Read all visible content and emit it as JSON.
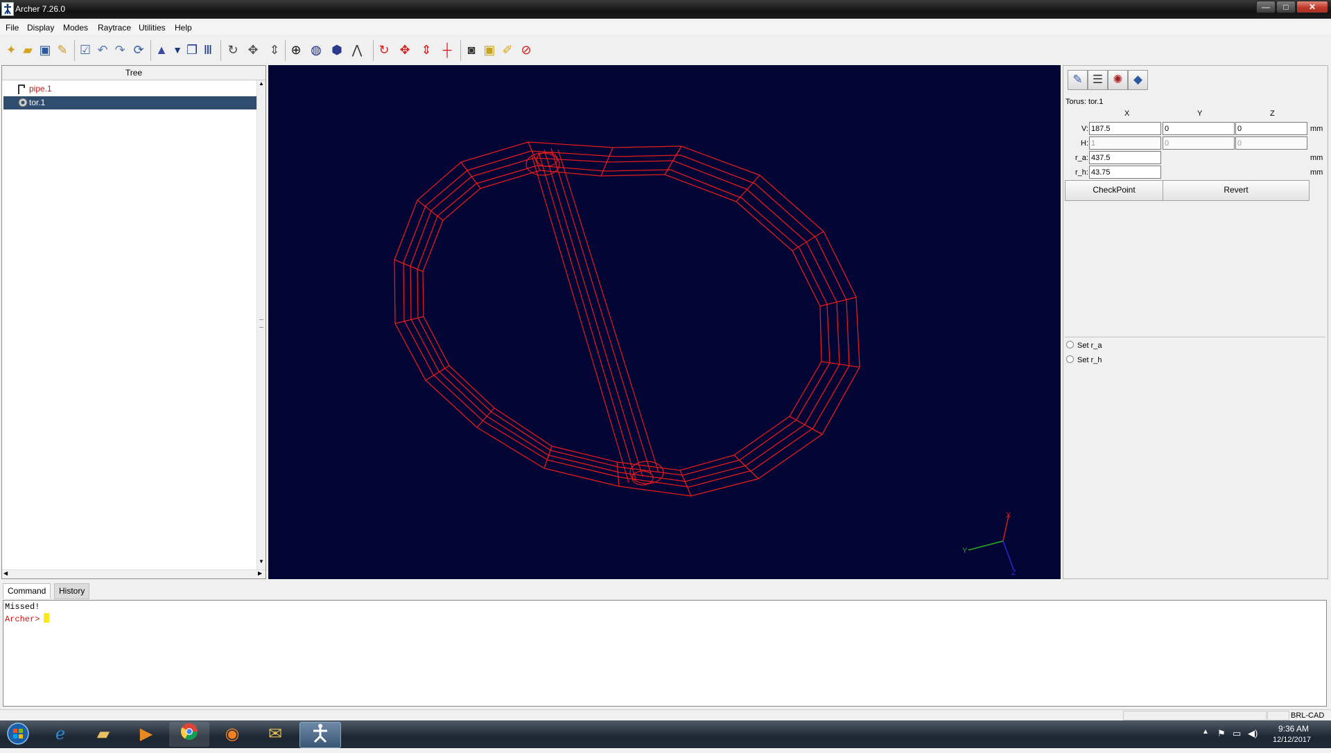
{
  "window": {
    "title": "Archer 7.26.0",
    "minimize_symbol": "—",
    "maximize_symbol": "□",
    "close_symbol": "✕"
  },
  "menu": [
    "File",
    "Display",
    "Modes",
    "Raytrace",
    "Utilities",
    "Help"
  ],
  "toolbar_icons": [
    "new-file-icon",
    "open-folder-icon",
    "save-icon",
    "wrench-icon",
    "check-edit-icon",
    "undo-icon",
    "redo-icon",
    "refresh-icon",
    "wizard-hat-icon",
    "arrow-down-icon",
    "overlap-icon",
    "bars-icon",
    "rotate-icon",
    "move-icon",
    "up-down-icon",
    "crosshair-icon",
    "globe-icon",
    "cube-icon",
    "compass-icon",
    "red-rotate-icon",
    "red-move-icon",
    "red-updown-icon",
    "red-crosshair-icon",
    "camera-icon",
    "photo-icon",
    "brush-icon",
    "no-entry-icon"
  ],
  "tree": {
    "header": "Tree",
    "items": [
      {
        "label": "pipe.1",
        "icon": "pipe-icon",
        "color": "#c41818",
        "selected": false
      },
      {
        "label": "tor.1",
        "icon": "torus-icon",
        "color": "#ffffff",
        "selected": true
      }
    ]
  },
  "viewport": {
    "bg_color": "#020434",
    "wire_color": "#e31c1c",
    "axes": {
      "x": "X",
      "y": "Y",
      "z": "Z"
    }
  },
  "right_panel": {
    "tool_icons": [
      "edit-pencil-icon",
      "table-icon",
      "mesh-icon",
      "surface-icon"
    ],
    "object_title": "Torus: tor.1",
    "axes": [
      "X",
      "Y",
      "Z"
    ],
    "params": [
      {
        "label": "V:",
        "x": "187.5",
        "y": "0",
        "z": "0",
        "unit": "mm",
        "enabled": true
      },
      {
        "label": "H:",
        "x": "1",
        "y": "0",
        "z": "0",
        "unit": "",
        "enabled": false
      },
      {
        "label": "r_a:",
        "x": "437.5",
        "unit": "mm",
        "enabled": true
      },
      {
        "label": "r_h:",
        "x": "43.75",
        "unit": "mm",
        "enabled": true
      }
    ],
    "checkpoint_label": "CheckPoint",
    "revert_label": "Revert",
    "radio_options": [
      "Set r_a",
      "Set r_h"
    ]
  },
  "command": {
    "tabs": [
      "Command",
      "History"
    ],
    "active_tab": "Command",
    "lines": [
      {
        "text": "Missed!",
        "color": "#000000"
      },
      {
        "text": "Archer>",
        "color": "#d01010"
      }
    ]
  },
  "status": {
    "right_text": "BRL-CAD"
  },
  "taskbar": {
    "items": [
      "start-orb-icon",
      "internet-explorer-icon",
      "file-explorer-icon",
      "media-player-icon",
      "chrome-icon",
      "firefox-icon",
      "email-folder-icon",
      "archer-app-icon"
    ],
    "tray_icons": [
      "tray-arrow-icon",
      "flag-icon",
      "network-icon",
      "volume-icon"
    ],
    "time": "9:36 AM",
    "date": "12/12/2017"
  }
}
